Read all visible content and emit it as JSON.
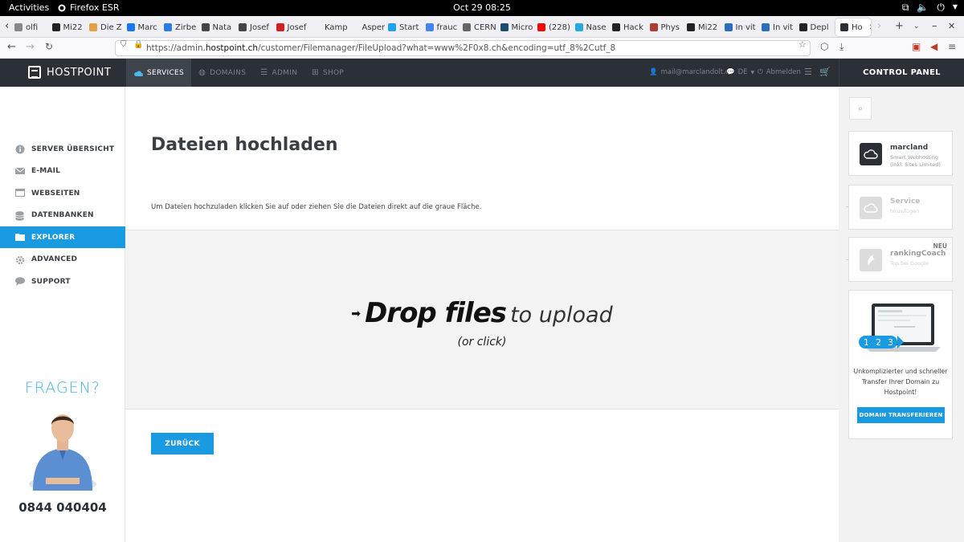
{
  "system_bar": {
    "activities": "Activities",
    "app_name": "Firefox ESR",
    "clock": "Oct 29  08:25"
  },
  "browser": {
    "tabs": [
      {
        "label": "olfi",
        "color": "#888888"
      },
      {
        "label": "Mi22",
        "color": "#222222"
      },
      {
        "label": "Die Z",
        "color": "#e6a04a"
      },
      {
        "label": "Marc",
        "color": "#1877f2"
      },
      {
        "label": "Zirbe",
        "color": "#2a7de1"
      },
      {
        "label": "Nata",
        "color": "#444444"
      },
      {
        "label": "Josef",
        "color": "#444444"
      },
      {
        "label": "Josef",
        "color": "#d21f26"
      },
      {
        "label": "Kampus",
        "color": "#f0f0f4"
      },
      {
        "label": "Aspergi",
        "color": "#f0f0f4"
      },
      {
        "label": "Start",
        "color": "#1da1f2"
      },
      {
        "label": "frauc",
        "color": "#4285f4"
      },
      {
        "label": "CERN",
        "color": "#666666"
      },
      {
        "label": "Micro",
        "color": "#1b4f72"
      },
      {
        "label": "(228)",
        "color": "#ff0000"
      },
      {
        "label": "Nase",
        "color": "#29a8e0"
      },
      {
        "label": "Hack",
        "color": "#222222"
      },
      {
        "label": "Phys",
        "color": "#b03a2e"
      },
      {
        "label": "Mi22",
        "color": "#222222"
      },
      {
        "label": "In vit",
        "color": "#2a6ebd"
      },
      {
        "label": "In vit",
        "color": "#2a6ebd"
      },
      {
        "label": "Depl",
        "color": "#222222"
      }
    ],
    "active_tab": {
      "label": "Ho",
      "color": "#2b3036"
    },
    "url_prefix": "https://admin.",
    "url_host": "hostpoint.ch",
    "url_path": "/customer/Filemanager/FileUpload?what=www%2F0x8.ch&encoding=utf_8%2Cutf_8"
  },
  "header": {
    "logo": "HOSTPOINT",
    "nav": [
      {
        "label": "SERVICES",
        "active": true
      },
      {
        "label": "DOMAINS",
        "active": false
      },
      {
        "label": "ADMIN",
        "active": false
      },
      {
        "label": "SHOP",
        "active": false
      }
    ],
    "email": "mail@marclandolt.ch",
    "language": "DE",
    "logout": "Abmelden",
    "control_panel": "CONTROL PANEL"
  },
  "sidebar": {
    "items": [
      {
        "label": "SERVER ÜBERSICHT",
        "icon": "info-icon"
      },
      {
        "label": "E-MAIL",
        "icon": "envelope-icon"
      },
      {
        "label": "WEBSEITEN",
        "icon": "window-icon"
      },
      {
        "label": "DATENBANKEN",
        "icon": "database-icon"
      },
      {
        "label": "EXPLORER",
        "icon": "folder-icon",
        "active": true
      },
      {
        "label": "ADVANCED",
        "icon": "gear-icon"
      },
      {
        "label": "SUPPORT",
        "icon": "speech-bubble-icon"
      }
    ],
    "fragen": "FRAGEN?",
    "phone": "0844 040404"
  },
  "main": {
    "title": "Dateien hochladen",
    "description": "Um Dateien hochzuladen klicken Sie auf oder ziehen Sie die Dateien direkt auf die graue Fläche.",
    "drop_big": "Drop files",
    "drop_small": "to upload",
    "drop_or": "(or click)",
    "back_button": "ZURÜCK"
  },
  "right_panel": {
    "cards": [
      {
        "title": "marcland",
        "subtitle": "Smart Webhosting (inkl. Sites Limited)"
      },
      {
        "title": "Service",
        "subtitle": "hinzufügen"
      },
      {
        "title": "rankingCoach",
        "subtitle": "Top bei Google",
        "badge": "NEU"
      }
    ],
    "promo_steps": [
      "1",
      "2",
      "3"
    ],
    "promo_text": "Unkomplizierter und schneller Transfer Ihrer Domain zu Hostpoint!",
    "promo_button": "DOMAIN TRANSFERIEREN"
  },
  "colors": {
    "accent": "#1a9ae0",
    "header_bg": "#2b3036",
    "fragen": "#3fb3e3"
  }
}
